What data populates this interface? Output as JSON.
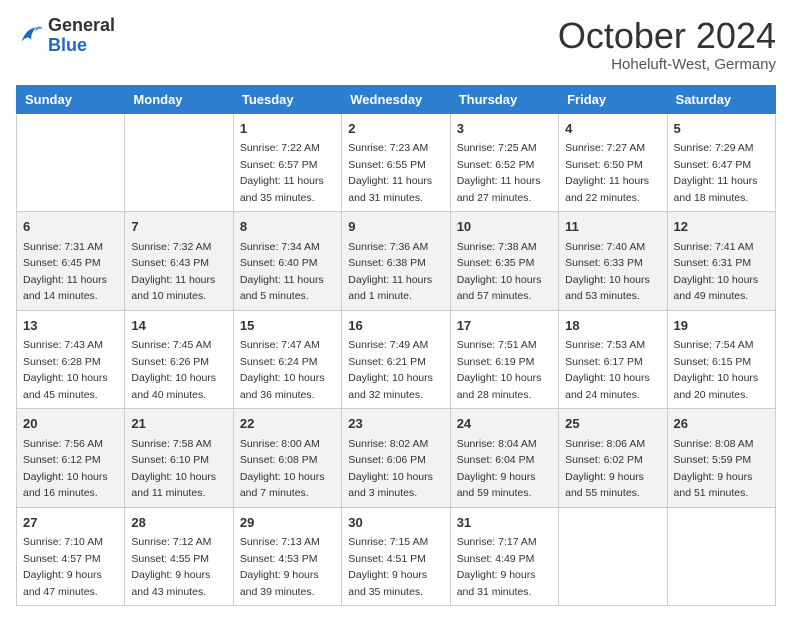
{
  "header": {
    "logo_general": "General",
    "logo_blue": "Blue",
    "month_title": "October 2024",
    "location": "Hoheluft-West, Germany"
  },
  "calendar": {
    "weekdays": [
      "Sunday",
      "Monday",
      "Tuesday",
      "Wednesday",
      "Thursday",
      "Friday",
      "Saturday"
    ],
    "weeks": [
      [
        {
          "day": "",
          "info": ""
        },
        {
          "day": "",
          "info": ""
        },
        {
          "day": "1",
          "info": "Sunrise: 7:22 AM\nSunset: 6:57 PM\nDaylight: 11 hours and 35 minutes."
        },
        {
          "day": "2",
          "info": "Sunrise: 7:23 AM\nSunset: 6:55 PM\nDaylight: 11 hours and 31 minutes."
        },
        {
          "day": "3",
          "info": "Sunrise: 7:25 AM\nSunset: 6:52 PM\nDaylight: 11 hours and 27 minutes."
        },
        {
          "day": "4",
          "info": "Sunrise: 7:27 AM\nSunset: 6:50 PM\nDaylight: 11 hours and 22 minutes."
        },
        {
          "day": "5",
          "info": "Sunrise: 7:29 AM\nSunset: 6:47 PM\nDaylight: 11 hours and 18 minutes."
        }
      ],
      [
        {
          "day": "6",
          "info": "Sunrise: 7:31 AM\nSunset: 6:45 PM\nDaylight: 11 hours and 14 minutes."
        },
        {
          "day": "7",
          "info": "Sunrise: 7:32 AM\nSunset: 6:43 PM\nDaylight: 11 hours and 10 minutes."
        },
        {
          "day": "8",
          "info": "Sunrise: 7:34 AM\nSunset: 6:40 PM\nDaylight: 11 hours and 5 minutes."
        },
        {
          "day": "9",
          "info": "Sunrise: 7:36 AM\nSunset: 6:38 PM\nDaylight: 11 hours and 1 minute."
        },
        {
          "day": "10",
          "info": "Sunrise: 7:38 AM\nSunset: 6:35 PM\nDaylight: 10 hours and 57 minutes."
        },
        {
          "day": "11",
          "info": "Sunrise: 7:40 AM\nSunset: 6:33 PM\nDaylight: 10 hours and 53 minutes."
        },
        {
          "day": "12",
          "info": "Sunrise: 7:41 AM\nSunset: 6:31 PM\nDaylight: 10 hours and 49 minutes."
        }
      ],
      [
        {
          "day": "13",
          "info": "Sunrise: 7:43 AM\nSunset: 6:28 PM\nDaylight: 10 hours and 45 minutes."
        },
        {
          "day": "14",
          "info": "Sunrise: 7:45 AM\nSunset: 6:26 PM\nDaylight: 10 hours and 40 minutes."
        },
        {
          "day": "15",
          "info": "Sunrise: 7:47 AM\nSunset: 6:24 PM\nDaylight: 10 hours and 36 minutes."
        },
        {
          "day": "16",
          "info": "Sunrise: 7:49 AM\nSunset: 6:21 PM\nDaylight: 10 hours and 32 minutes."
        },
        {
          "day": "17",
          "info": "Sunrise: 7:51 AM\nSunset: 6:19 PM\nDaylight: 10 hours and 28 minutes."
        },
        {
          "day": "18",
          "info": "Sunrise: 7:53 AM\nSunset: 6:17 PM\nDaylight: 10 hours and 24 minutes."
        },
        {
          "day": "19",
          "info": "Sunrise: 7:54 AM\nSunset: 6:15 PM\nDaylight: 10 hours and 20 minutes."
        }
      ],
      [
        {
          "day": "20",
          "info": "Sunrise: 7:56 AM\nSunset: 6:12 PM\nDaylight: 10 hours and 16 minutes."
        },
        {
          "day": "21",
          "info": "Sunrise: 7:58 AM\nSunset: 6:10 PM\nDaylight: 10 hours and 11 minutes."
        },
        {
          "day": "22",
          "info": "Sunrise: 8:00 AM\nSunset: 6:08 PM\nDaylight: 10 hours and 7 minutes."
        },
        {
          "day": "23",
          "info": "Sunrise: 8:02 AM\nSunset: 6:06 PM\nDaylight: 10 hours and 3 minutes."
        },
        {
          "day": "24",
          "info": "Sunrise: 8:04 AM\nSunset: 6:04 PM\nDaylight: 9 hours and 59 minutes."
        },
        {
          "day": "25",
          "info": "Sunrise: 8:06 AM\nSunset: 6:02 PM\nDaylight: 9 hours and 55 minutes."
        },
        {
          "day": "26",
          "info": "Sunrise: 8:08 AM\nSunset: 5:59 PM\nDaylight: 9 hours and 51 minutes."
        }
      ],
      [
        {
          "day": "27",
          "info": "Sunrise: 7:10 AM\nSunset: 4:57 PM\nDaylight: 9 hours and 47 minutes."
        },
        {
          "day": "28",
          "info": "Sunrise: 7:12 AM\nSunset: 4:55 PM\nDaylight: 9 hours and 43 minutes."
        },
        {
          "day": "29",
          "info": "Sunrise: 7:13 AM\nSunset: 4:53 PM\nDaylight: 9 hours and 39 minutes."
        },
        {
          "day": "30",
          "info": "Sunrise: 7:15 AM\nSunset: 4:51 PM\nDaylight: 9 hours and 35 minutes."
        },
        {
          "day": "31",
          "info": "Sunrise: 7:17 AM\nSunset: 4:49 PM\nDaylight: 9 hours and 31 minutes."
        },
        {
          "day": "",
          "info": ""
        },
        {
          "day": "",
          "info": ""
        }
      ]
    ]
  }
}
